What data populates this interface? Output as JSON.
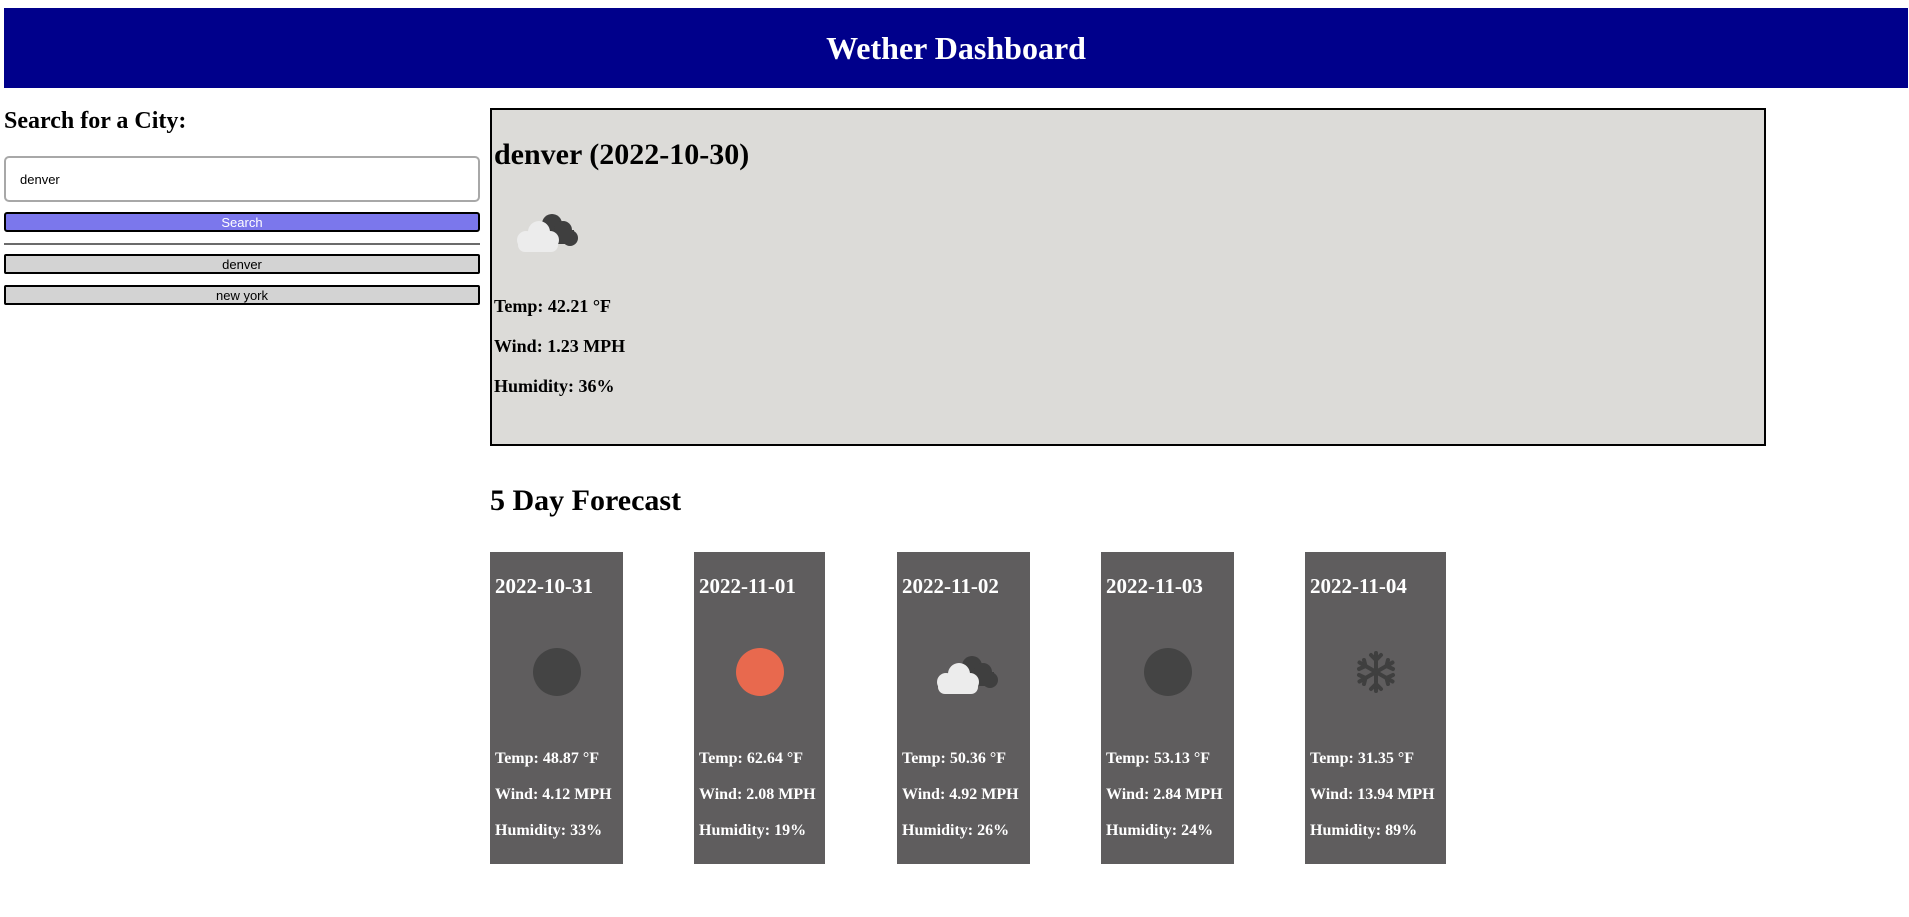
{
  "header": {
    "title": "Wether Dashboard"
  },
  "sidebar": {
    "heading": "Search for a City:",
    "search_value": "denver",
    "search_button": "Search",
    "history": [
      "denver",
      "new york"
    ]
  },
  "current": {
    "title": "denver (2022-10-30)",
    "icon": "clouds-icon",
    "temp": "Temp: 42.21 °F",
    "wind": "Wind: 1.23 MPH",
    "humidity": "Humidity: 36%"
  },
  "forecast": {
    "heading": "5 Day Forecast",
    "days": [
      {
        "date": "2022-10-31",
        "icon": "dark-circle-icon",
        "temp": "Temp: 48.87 °F",
        "wind": "Wind: 4.12 MPH",
        "humidity": "Humidity: 33%"
      },
      {
        "date": "2022-11-01",
        "icon": "sun-icon",
        "temp": "Temp: 62.64 °F",
        "wind": "Wind: 2.08 MPH",
        "humidity": "Humidity: 19%"
      },
      {
        "date": "2022-11-02",
        "icon": "clouds-icon",
        "temp": "Temp: 50.36 °F",
        "wind": "Wind: 4.92 MPH",
        "humidity": "Humidity: 26%"
      },
      {
        "date": "2022-11-03",
        "icon": "dark-circle-icon",
        "temp": "Temp: 53.13 °F",
        "wind": "Wind: 2.84 MPH",
        "humidity": "Humidity: 24%"
      },
      {
        "date": "2022-11-04",
        "icon": "snowflake-icon",
        "temp": "Temp: 31.35 °F",
        "wind": "Wind: 13.94 MPH",
        "humidity": "Humidity: 89%"
      }
    ]
  },
  "colors": {
    "header_bg": "#00008b",
    "search_button_bg": "#7b77ec",
    "history_button_bg": "#d3d3d3",
    "current_card_bg": "#dcdbd8",
    "forecast_card_bg": "#5f5d5e",
    "sun": "#e8694e",
    "dark_icon": "#444444"
  }
}
